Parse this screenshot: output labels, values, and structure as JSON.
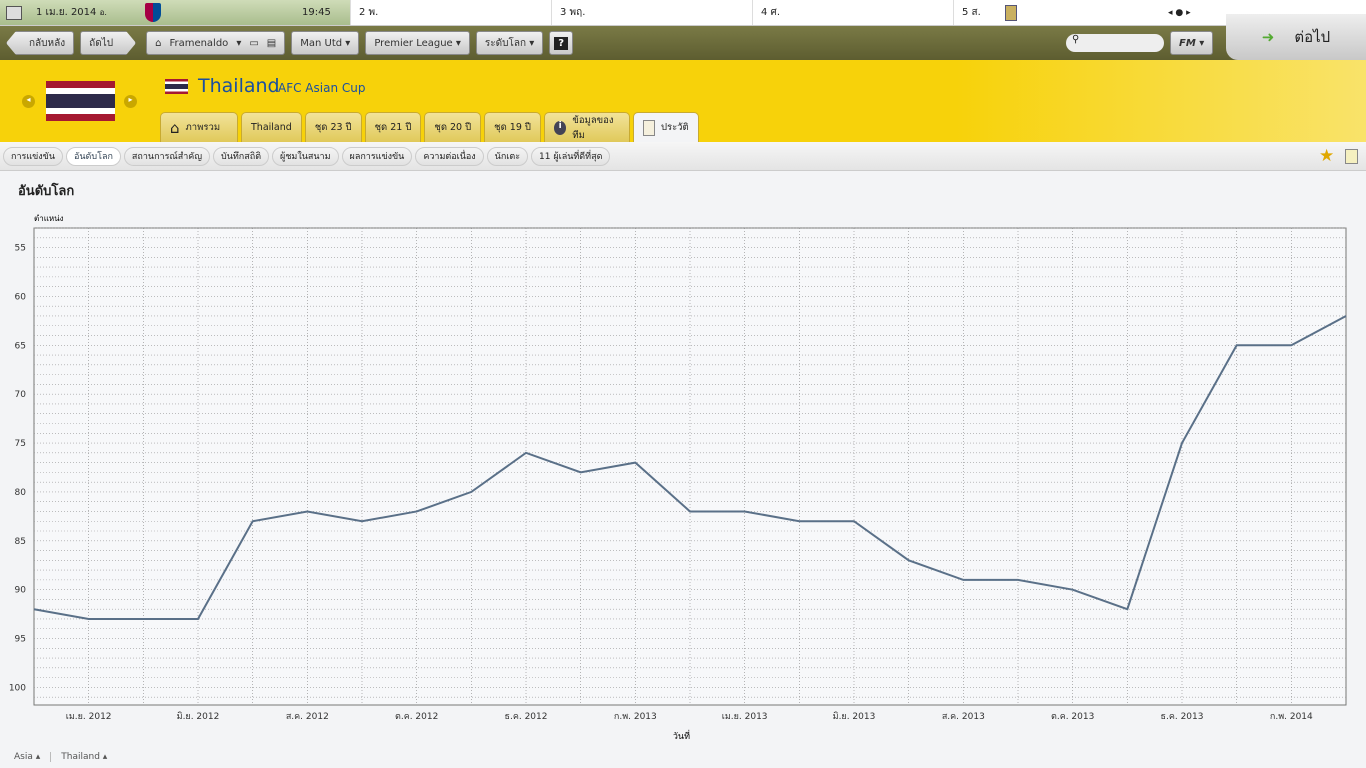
{
  "topbar": {
    "date": "1 เม.ย. 2014",
    "weekday": "อ.",
    "time": "19:45",
    "days": [
      {
        "label": "2 พ."
      },
      {
        "label": "3 พฤ."
      },
      {
        "label": "4 ศ."
      },
      {
        "label": "5 ส."
      }
    ]
  },
  "nav": {
    "back": "กลับหลัง",
    "forward": "ถัดไป",
    "manager": "Framenaldo",
    "club": "Man Utd",
    "league": "Premier League",
    "world": "ระดับโลก",
    "help": "?",
    "continue": "ต่อไป",
    "fm": "FM"
  },
  "header": {
    "team": "Thailand",
    "competition": "AFC Asian Cup",
    "flag_colors": [
      "#a51931",
      "#ffffff",
      "#2d2a4a"
    ]
  },
  "tabs": [
    "ภาพรวม",
    "Thailand",
    "ชุด 23 ปี",
    "ชุด 21 ปี",
    "ชุด 20 ปี",
    "ชุด 19 ปี",
    "ข้อมูลของทีม",
    "ประวัติ"
  ],
  "subtabs": [
    "การแข่งขัน",
    "อันดับโลก",
    "สถานการณ์สำคัญ",
    "บันทึกสถิติ",
    "ผู้ชมในสนาม",
    "ผลการแข่งขัน",
    "ความต่อเนื่อง",
    "นักเตะ",
    "11 ผู้เล่นที่ดีที่สุด"
  ],
  "page_title": "อันดับโลก",
  "footer": {
    "region": "Asia",
    "nation": "Thailand"
  },
  "chart_data": {
    "type": "line",
    "title": "อันดับโลก",
    "ylabel": "ตำแหน่ง",
    "xlabel": "วันที่",
    "ylim": [
      53,
      101.8
    ],
    "inverted": true,
    "yticks": [
      55,
      60,
      65,
      70,
      75,
      80,
      85,
      90,
      95,
      100
    ],
    "xticklabels": [
      "เม.ย. 2012",
      "มิ.ย. 2012",
      "ส.ค. 2012",
      "ต.ค. 2012",
      "ธ.ค. 2012",
      "ก.พ. 2013",
      "เม.ย. 2013",
      "มิ.ย. 2013",
      "ส.ค. 2013",
      "ต.ค. 2013",
      "ธ.ค. 2013",
      "ก.พ. 2014"
    ],
    "values": [
      92,
      93,
      93,
      93,
      83,
      82,
      83,
      82,
      80,
      76,
      78,
      77,
      82,
      82,
      83,
      83,
      87,
      89,
      89,
      90,
      92,
      75,
      65,
      65,
      62
    ],
    "line_color": "#5a7088"
  }
}
